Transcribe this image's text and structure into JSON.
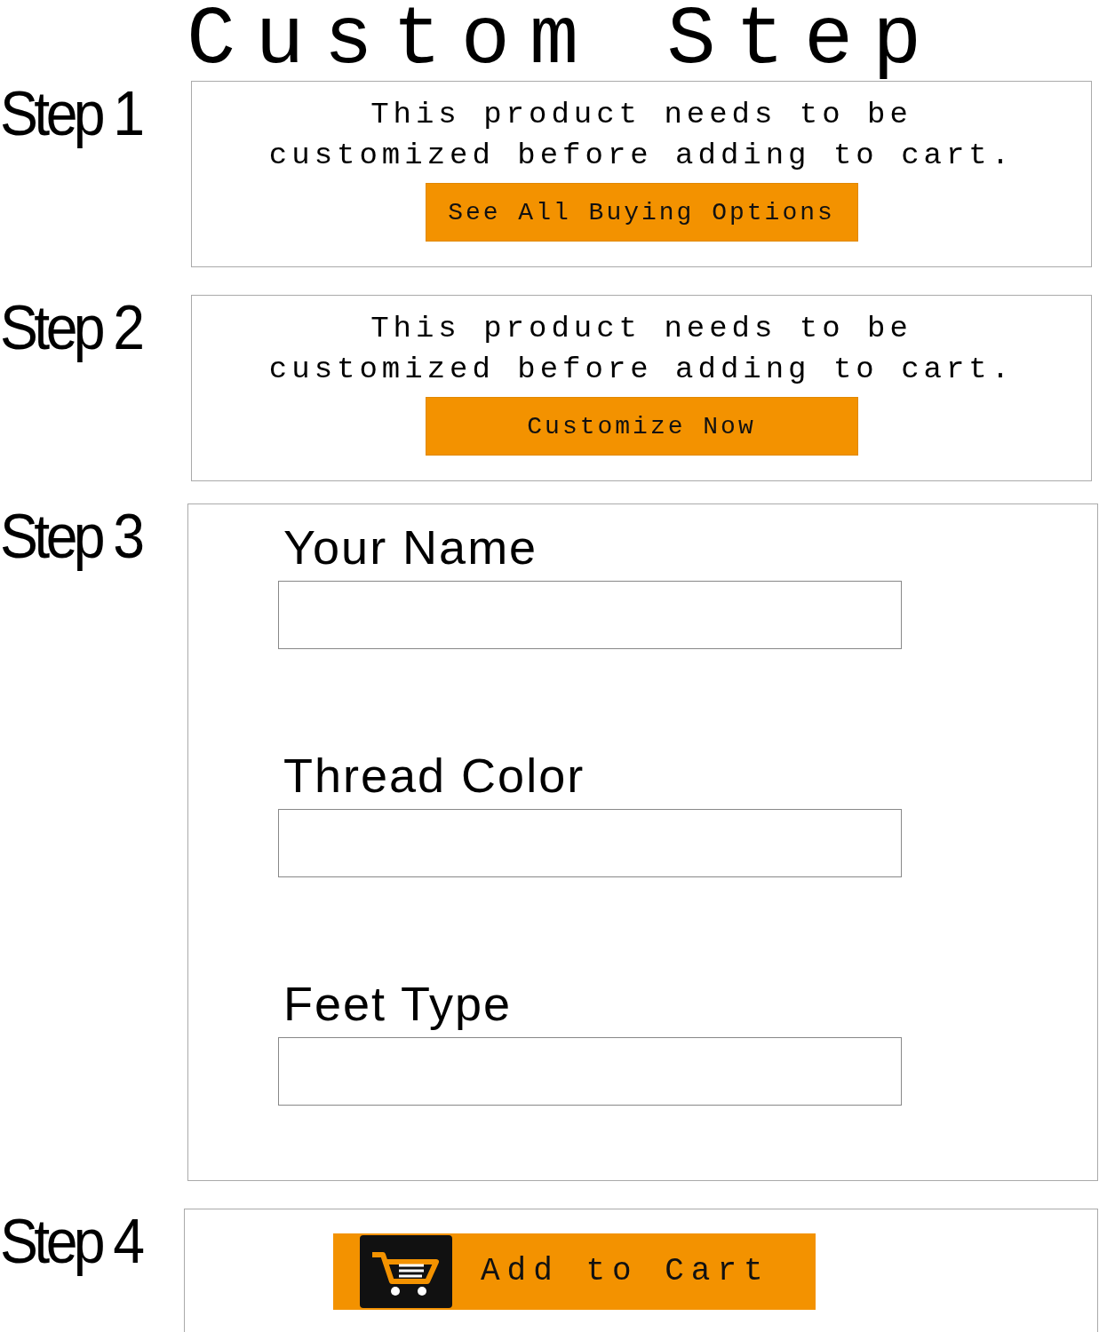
{
  "title": "Custom Step",
  "steps": [
    {
      "label": "Step 1",
      "kind": "notice",
      "message": "This product needs to be customized before adding to cart.",
      "button": "See All Buying Options"
    },
    {
      "label": "Step 2",
      "kind": "notice",
      "message": "This product needs to be customized before adding to cart.",
      "button": "Customize Now"
    },
    {
      "label": "Step 3",
      "kind": "form",
      "fields": [
        {
          "label": "Your Name"
        },
        {
          "label": "Thread Color"
        },
        {
          "label": "Feet Type"
        }
      ]
    },
    {
      "label": "Step 4",
      "kind": "cart",
      "button": "Add to Cart"
    }
  ]
}
